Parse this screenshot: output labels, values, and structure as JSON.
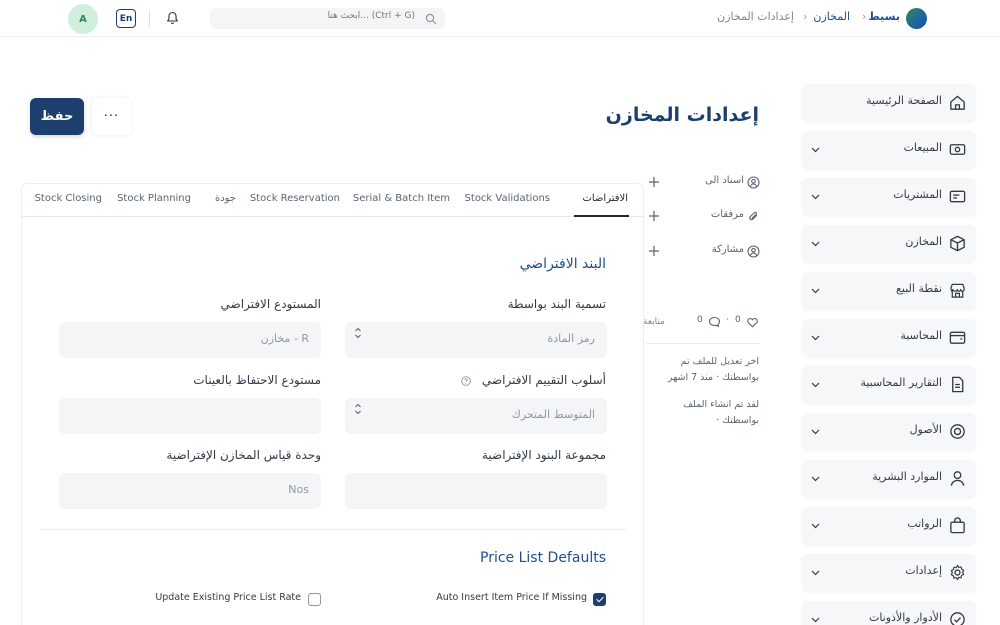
{
  "navbar": {
    "brand": "بسيط",
    "breadcrumb_parent": "المخازن",
    "breadcrumb_current": "إعدادات المخازن",
    "breadcrumb_separator": "›",
    "search_placeholder": "ابحث هنا... (Ctrl + G)",
    "lang_label": "En",
    "avatar_initial": "A"
  },
  "page": {
    "title": "إعدادات المخازن",
    "save_label": "حفظ",
    "more_label": "···"
  },
  "sidebar": {
    "items": [
      {
        "label": "الصفحة الرئيسية",
        "icon": "home-icon"
      },
      {
        "label": "المبيعات",
        "icon": "sales-icon"
      },
      {
        "label": "المشتريات",
        "icon": "purchases-icon"
      },
      {
        "label": "المخازن",
        "icon": "box-icon"
      },
      {
        "label": "نقطة البيع",
        "icon": "store-icon"
      },
      {
        "label": "المحاسبة",
        "icon": "wallet-icon"
      },
      {
        "label": "التقارير المحاسبية",
        "icon": "report-icon"
      },
      {
        "label": "الأصول",
        "icon": "assets-icon"
      },
      {
        "label": "الموارد البشرية",
        "icon": "user-icon"
      },
      {
        "label": "الرواتب",
        "icon": "bag-icon"
      },
      {
        "label": "إعدادات",
        "icon": "gear-icon"
      },
      {
        "label": "الأدوار والأذونات",
        "icon": "check-circle-icon"
      }
    ]
  },
  "timeline": {
    "assign_label": "اسناد الى",
    "attachments_label": "مرفقات",
    "share_label": "مشاركة",
    "follow_label": "متابعة",
    "likes_count": "0",
    "comments_count": "0",
    "count_separator": "·",
    "activity_1_line1": "اخر تعديل للملف تم",
    "activity_1_line2": "بواسطتك · منذ 7 اشهر",
    "activity_2_line1": "لقد تم انشاء الملف",
    "activity_2_line2": "بواسطتك ·"
  },
  "tabs": [
    {
      "label": "الافتراضات",
      "active": true
    },
    {
      "label": "Stock Validations"
    },
    {
      "label": "Serial & Batch Item"
    },
    {
      "label": "Stock Reservation"
    },
    {
      "label": "جودة"
    },
    {
      "label": "Stock Planning"
    },
    {
      "label": "Stock Closing"
    }
  ],
  "form": {
    "section1_title": "البند الافتراضي",
    "item_naming_label": "تسمية البند بواسطة",
    "item_naming_value": "رمز المادة",
    "default_warehouse_label": "المستودع الافتراضي",
    "default_warehouse_value": "مخازن - R",
    "valuation_label": "أسلوب التقييم الافتراضي",
    "valuation_value": "المتوسط المتحرك",
    "sample_warehouse_label": "مستودع الاحتفاظ بالعينات",
    "sample_warehouse_value": "",
    "item_group_label": "مجموعة البنود الإفتراضية",
    "item_group_value": "",
    "stock_uom_label": "وحدة قياس المخازن الإفتراضية",
    "stock_uom_value": "Nos",
    "section2_title": "Price List Defaults",
    "auto_insert_label": "Auto Insert Item Price If Missing",
    "auto_insert_checked": true,
    "update_existing_label": "Update Existing Price List Rate",
    "update_existing_checked": false
  },
  "colors": {
    "primary": "#1d3f6e",
    "link": "#1d4f91",
    "field_bg": "#f4f5f6"
  }
}
